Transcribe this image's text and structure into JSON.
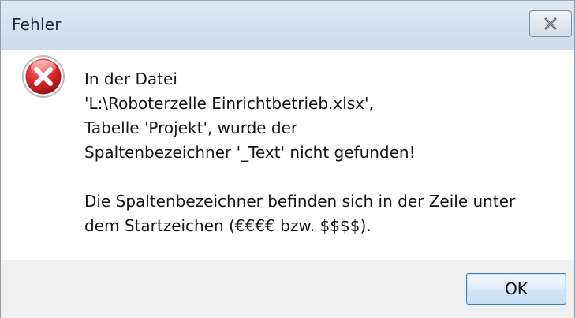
{
  "window": {
    "title": "Fehler",
    "close_icon": "close-icon"
  },
  "message": {
    "icon": "error-icon",
    "lines": [
      "In der Datei",
      "'L:\\Roboterzelle Einrichtbetrieb.xlsx',",
      "Tabelle 'Projekt', wurde der",
      "Spaltenbezeichner '_Text' nicht gefunden!",
      "",
      "Die Spaltenbezeichner befinden sich in der Zeile unter",
      "dem Startzeichen (€€€€ bzw. $$$$)."
    ]
  },
  "buttons": {
    "ok_label": "OK"
  },
  "colors": {
    "error_red": "#d7262b",
    "titlebar": "#d4e1f1",
    "footer": "#f0f0f0"
  }
}
